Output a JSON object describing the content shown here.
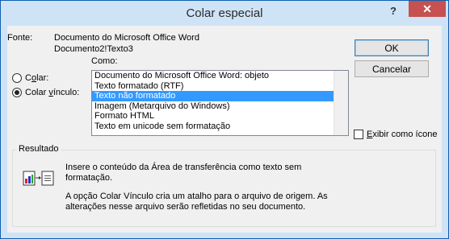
{
  "window": {
    "title": "Colar especial",
    "help_glyph": "?",
    "close_glyph": "✕"
  },
  "source": {
    "label": "Fonte:",
    "line1": "Documento do Microsoft Office Word",
    "line2": "Documento2!Texto3"
  },
  "como_label": "Como:",
  "options": {
    "colar_prefix": "C",
    "colar_u": "o",
    "colar_suffix": "lar:",
    "vinculo_prefix": "Colar ",
    "vinculo_u": "v",
    "vinculo_suffix": "ínculo:"
  },
  "formats": [
    "Documento do Microsoft Office Word: objeto",
    "Texto formatado (RTF)",
    "Texto não formatado",
    "Imagem (Metarquivo do Windows)",
    "Formato HTML",
    "Texto em unicode sem formatação"
  ],
  "selected_format": "Texto não formatado",
  "buttons": {
    "ok": "OK",
    "cancel": "Cancelar"
  },
  "display_as_icon": {
    "prefix": "",
    "u": "E",
    "suffix": "xibir como ícone",
    "checked": false
  },
  "result": {
    "label": "Resultado",
    "text1_line1": "Insere o conteúdo da Área de transferência como texto sem",
    "text1_line2": "formatação.",
    "text2_line1": "A opção Colar Vínculo cria um atalho para o arquivo de origem. As",
    "text2_line2": "alterações nesse arquivo serão refletidas no seu documento."
  },
  "colors": {
    "selection": "#3399ff",
    "close": "#c75050",
    "frame": "#cfe3f7"
  }
}
